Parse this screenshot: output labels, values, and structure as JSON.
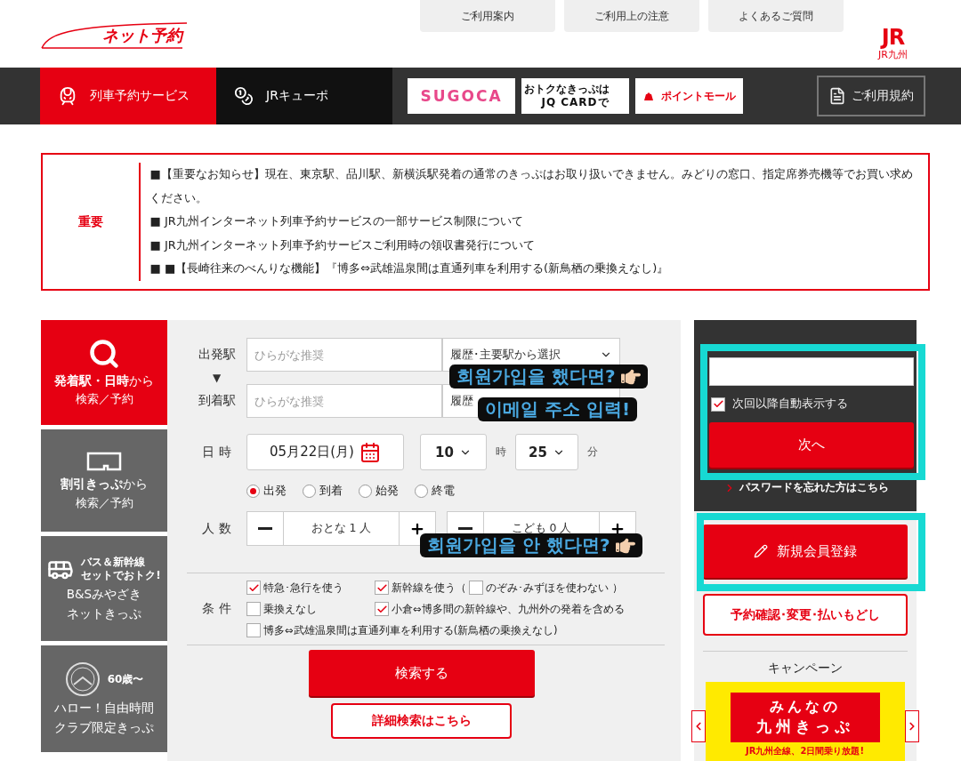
{
  "header": {
    "logo": "ネット予約",
    "top_links": [
      "ご利用案内",
      "ご利用上の注意",
      "よくあるご質問"
    ],
    "jr_logo": "JR",
    "jr_sub": "JR九州"
  },
  "navbar": {
    "tabs": [
      {
        "label": "列車予約サービス",
        "selected": true
      },
      {
        "label": "JRキューポ",
        "selected": false
      }
    ],
    "banners": [
      {
        "kind": "sugoca",
        "text": "SUGOCA"
      },
      {
        "kind": "jqcard",
        "small": "おトクなきっぷは",
        "text": "JQ CARDで"
      },
      {
        "kind": "point",
        "text": "ポイントモール"
      }
    ],
    "terms": "ご利用規約"
  },
  "notice": {
    "label": "重要",
    "items": [
      "■【重要なお知らせ】現在、東京駅、品川駅、新横浜駅発着の通常のきっぷはお取り扱いできません。みどりの窓口、指定席券売機等でお買い求めください。",
      "■ JR九州インターネット列車予約サービスの一部サービス制限について",
      "■ JR九州インターネット列車予約サービスご利用時の領収書発行について",
      "■ ■【長崎往来のべんりな機能】『博多⇔武雄温泉間は直通列車を利用する(新鳥栖の乗換えなし)』"
    ]
  },
  "sidebar": [
    {
      "kind": "search",
      "title": "**発着駅・日時**から",
      "sub": "検索／予約",
      "selected": true
    },
    {
      "kind": "discount",
      "title": "**割引きっぷ**から",
      "sub": "検索／予約",
      "selected": false
    },
    {
      "kind": "bus",
      "badge": [
        "バス＆新幹線",
        "セットでおトク!"
      ],
      "title_lines": [
        "B&Sみやざき",
        "ネットきっぷ"
      ],
      "selected": false
    },
    {
      "kind": "senior",
      "badge": [
        "60歳〜"
      ],
      "title_lines": [
        "ハロー！自由時間",
        "クラブ限定きっぷ"
      ],
      "selected": false
    }
  ],
  "form": {
    "stations": [
      {
        "label": "出発駅",
        "placeholder": "ひらがな推奨",
        "select": "履歴･主要駅から選択"
      },
      {
        "label": "到着駅",
        "placeholder": "ひらがな推奨",
        "select": "履歴"
      }
    ],
    "arrow": "▼",
    "datetime": {
      "label": "日 時",
      "date": "05月22日(月)",
      "hour": "10",
      "hour_unit": "時",
      "minute": "25",
      "minute_unit": "分"
    },
    "time_modes": [
      {
        "label": "出発",
        "selected": true
      },
      {
        "label": "到着",
        "selected": false
      },
      {
        "label": "始発",
        "selected": false
      },
      {
        "label": "終電",
        "selected": false
      }
    ],
    "people": {
      "label": "人 数",
      "counters": [
        "おとな 1 人",
        "こども 0 人"
      ]
    },
    "conditions": {
      "label": "条 件",
      "rows": [
        [
          {
            "label": "特急･急行を使う",
            "checked": true
          },
          {
            "label": "新幹線を使う（",
            "checked": true,
            "nested": {
              "label": "のぞみ･みずほを使わない ）",
              "checked": false
            }
          }
        ],
        [
          {
            "label": "乗換えなし",
            "checked": false
          },
          {
            "label": "小倉⇔博多間の新幹線や、九州外の発着を含める",
            "checked": true
          }
        ],
        [
          {
            "label": "博多⇔武雄温泉間は直通列車を利用する(新鳥栖の乗換えなし)",
            "checked": false
          }
        ]
      ]
    },
    "search_button": "検索する",
    "detail_button": "詳細検索はこちら"
  },
  "member": {
    "remember": {
      "label": "次回以降自動表示する",
      "checked": true
    },
    "next_button": "次へ",
    "forgot_link": "パスワードを忘れた方はこちら",
    "register_button": "新規会員登録",
    "reservation_button": "予約確認･変更･払いもどし"
  },
  "campaign": {
    "heading": "キャンペーン",
    "banner_line1": "みんなの",
    "banner_line2": "九州きっぷ",
    "banner_caption": "JR九州全線、2日間乗り放題!"
  },
  "annotations": [
    "회원가입을 했다면?",
    "이메일 주소 입력!",
    "회원가입을 안 했다면?"
  ]
}
